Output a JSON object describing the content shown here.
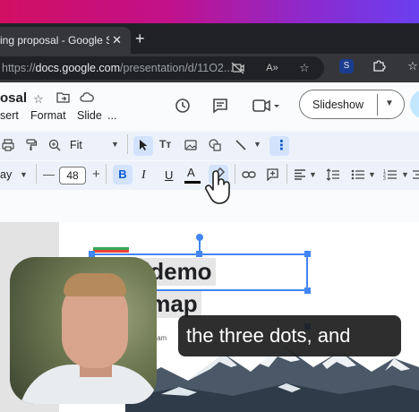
{
  "browser": {
    "tab_title": "ing proposal - Google Slid",
    "tab_close": "✕",
    "new_tab": "+",
    "url_prefix": "https://",
    "url_domain": "docs.google.com",
    "url_path": "/presentation/d/11O2..."
  },
  "docs": {
    "title": "osal",
    "menu": [
      "sert",
      "Format",
      "Slide",
      "..."
    ],
    "slideshow_label": "Slideshow"
  },
  "toolbar": {
    "zoom": "Fit",
    "font_size": "48",
    "bold": "B",
    "italic": "I",
    "underline": "U",
    "text_color": "A",
    "minus": "—",
    "plus": "+",
    "font_name": "ay"
  },
  "slide": {
    "title_line1": "idemo",
    "title_line2": "lmap",
    "subtitle": "r sit am"
  },
  "caption": {
    "text": "the three dots, and"
  },
  "colors": {
    "accent_green": "#34a853",
    "accent_red": "#ea4335",
    "selection_blue": "#4285f4"
  }
}
